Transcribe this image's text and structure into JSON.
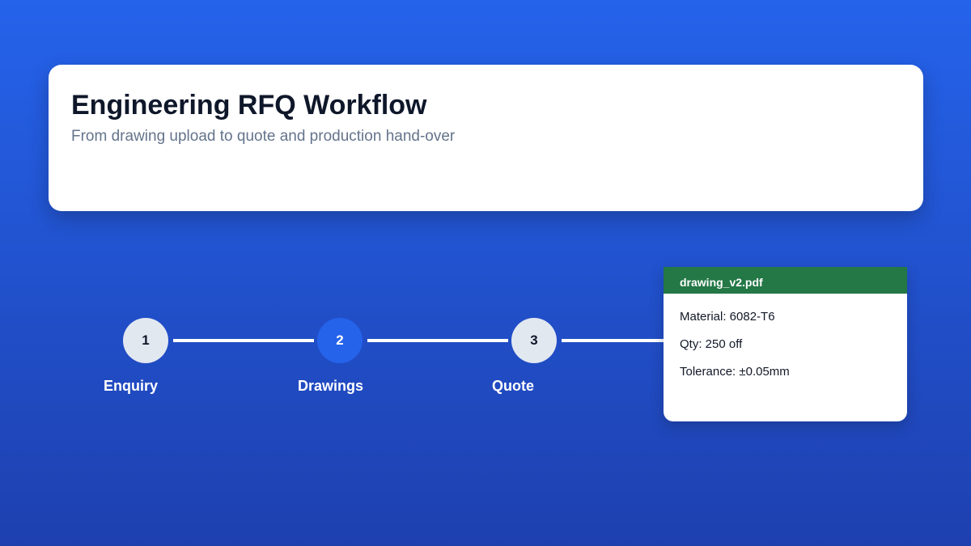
{
  "header": {
    "title": "Engineering RFQ Workflow",
    "subtitle": "From drawing upload to quote and production hand-over"
  },
  "steps": [
    {
      "number": "1",
      "label": "Enquiry",
      "state": "inactive"
    },
    {
      "number": "2",
      "label": "Drawings",
      "state": "active"
    },
    {
      "number": "3",
      "label": "Quote",
      "state": "inactive"
    }
  ],
  "file_card": {
    "filename": "drawing_v2.pdf",
    "material": "Material: 6082-T6",
    "quantity": "Qty: 250 off",
    "tolerance": "Tolerance: ±0.05mm"
  },
  "colors": {
    "background_top": "#2563eb",
    "background_bottom": "#1e40af",
    "active_step": "#2563eb",
    "inactive_step": "#e2e8f0",
    "file_header": "#237846"
  }
}
